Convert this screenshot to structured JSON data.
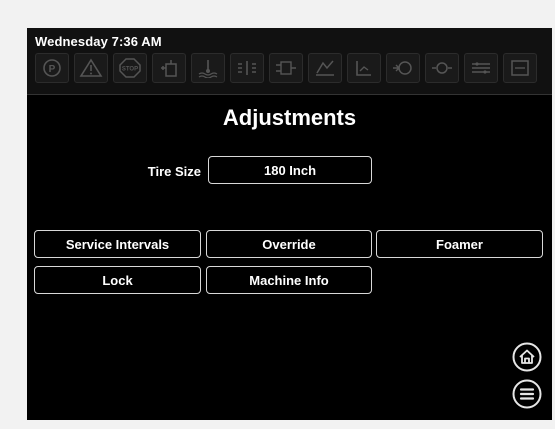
{
  "status": {
    "clock": "Wednesday 7:36 AM",
    "indicators": [
      "parking-brake-icon",
      "warning-triangle-icon",
      "stop-icon",
      "fuel-icon",
      "coolant-temp-icon",
      "hydraulic-pressure-icon",
      "hydraulic-filter-icon",
      "engine-fault-icon",
      "hydraulic-level-icon",
      "oil-pressure-icon",
      "engine-oil-icon",
      "transmission-icon",
      "service-icon"
    ]
  },
  "page": {
    "title": "Adjustments"
  },
  "tire": {
    "label": "Tire Size",
    "value": "180 Inch"
  },
  "buttons": {
    "service_intervals": "Service Intervals",
    "override": "Override",
    "foamer": "Foamer",
    "lock": "Lock",
    "machine_info": "Machine Info"
  },
  "nav": {
    "home": "home-icon",
    "menu": "menu-icon"
  }
}
